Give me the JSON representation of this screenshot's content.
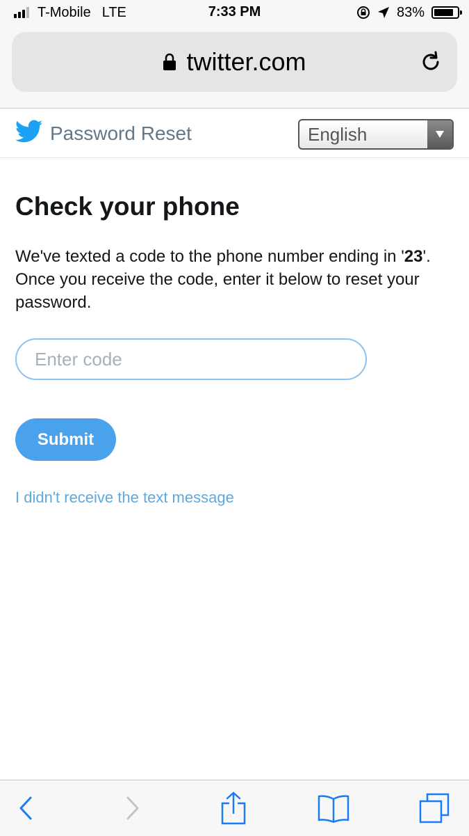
{
  "status_bar": {
    "carrier": "T-Mobile",
    "network": "LTE",
    "time": "7:33 PM",
    "battery_text": "83%",
    "battery_level": 0.83,
    "icons": [
      "signal-icon",
      "orientation-lock-icon",
      "location-arrow-icon",
      "battery-icon"
    ]
  },
  "browser": {
    "url": "twitter.com",
    "icons": [
      "lock-icon",
      "reload-icon"
    ]
  },
  "header": {
    "logo_icon": "twitter-bird-icon",
    "title": "Password Reset",
    "language_selected": "English",
    "brand_color": "#1da1f2"
  },
  "main": {
    "heading": "Check your phone",
    "description_part1": "We've texted a code to the phone number ending in '",
    "phone_digits": "23",
    "description_part2": "'. Once you receive the code, enter it below to reset your password.",
    "code_input": {
      "value": "",
      "placeholder": "Enter code"
    },
    "submit_label": "Submit",
    "resend_link": "I didn't receive the text message",
    "accent_color": "#4aa1ec"
  },
  "toolbar": {
    "icons": [
      "back-icon",
      "forward-icon",
      "share-icon",
      "bookmarks-icon",
      "tabs-icon"
    ]
  }
}
